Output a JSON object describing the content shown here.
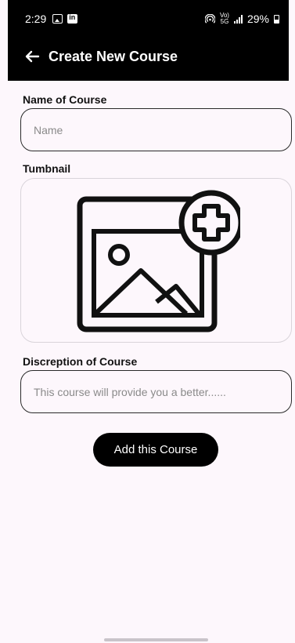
{
  "status_bar": {
    "time": "2:29",
    "network_top": "Vo)",
    "network_bottom": "5G",
    "battery": "29%"
  },
  "toolbar": {
    "title": "Create New Course",
    "back_icon": "arrow-left-icon"
  },
  "form": {
    "name_label": "Name of Course",
    "name_placeholder": "Name",
    "thumbnail_label": "Tumbnail",
    "thumbnail_icon": "add-image-icon",
    "description_label": "Discreption of Course",
    "description_placeholder": "This course will provide you a better......",
    "submit_label": "Add this Course"
  },
  "colors": {
    "header_bg": "#000000",
    "page_bg": "#fdf7fc",
    "button_bg": "#000000",
    "field_border": "#2a2a2a",
    "thumbnail_border": "#d9d4da"
  }
}
